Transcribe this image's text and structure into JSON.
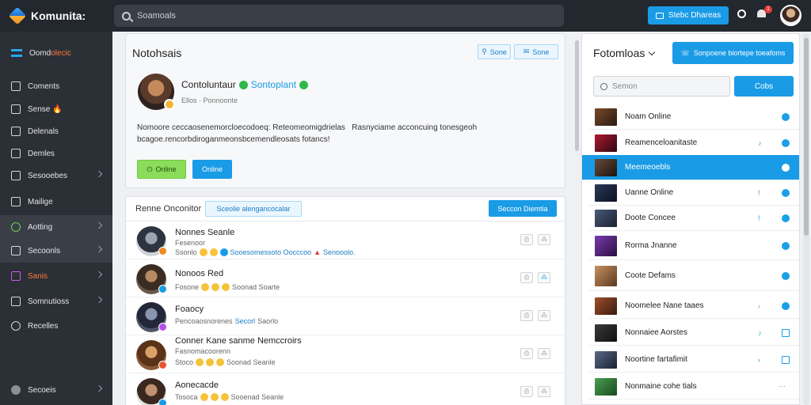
{
  "app": {
    "name": "Komunita:"
  },
  "top": {
    "search_placeholder": "Soamoals",
    "action_button": "Stebc Dhareas",
    "notif_count": "1"
  },
  "sidebar": {
    "items": [
      {
        "label": "Oomd",
        "accent": "olecic",
        "active": false
      },
      {
        "label": "Coments"
      },
      {
        "label": "Sense",
        "suffix": "🔥"
      },
      {
        "label": "Delenals"
      },
      {
        "label": "Demles"
      },
      {
        "label": "Sesooebes"
      },
      {
        "label": "Mailige"
      },
      {
        "label": "Aotting"
      },
      {
        "label": "Secoonls"
      },
      {
        "label": "Sanis"
      },
      {
        "label": "Somnutioss"
      },
      {
        "label": "Recelles"
      },
      {
        "label": "Secoeis"
      }
    ]
  },
  "notification": {
    "title": "Notohsais",
    "btn_a": "Sone",
    "btn_b": "Sone",
    "profile_name": "Contoluntaur",
    "profile_tag": "Sontoplant",
    "profile_sub": "Ellos · Ponnoonte",
    "text": "Nomoore ceccaosenemorcloecodoeq: Reteomeomigdrielas   Rasnyciame acconcuing tonesgeoh bcagoe.rencorbdiroganmeonsbcemendleosats fotancs!",
    "btn_green": "Online",
    "btn_blue": "Online"
  },
  "list": {
    "header": "Renne Onconitor",
    "tag": "Sceolie alengancocalar",
    "action": "Seccon Diemtia",
    "rows": [
      {
        "name": "Nonnes Seanle",
        "sub": "Fesenoor",
        "meta_a": "Ssonlo",
        "meta_link": "Sooesomessoto Oocccoo",
        "meta_b": "Senooolo."
      },
      {
        "name": "Nonoos Red",
        "sub": "",
        "meta_a": "Fosone",
        "meta_link": "",
        "meta_b": "Soonad Soarte"
      },
      {
        "name": "Foaocy",
        "sub": "",
        "meta_a": "Pencoaosnorenes",
        "meta_link": "Secorl",
        "meta_b": "Saorlo"
      },
      {
        "name": "Conner Kane sanme Nemccroirs",
        "sub": "Fasnomacoorenn",
        "meta_a": "Stoco",
        "meta_link": "",
        "meta_b": "Soonad Seanle"
      },
      {
        "name": "Aonecacde",
        "sub": "",
        "meta_a": "Tosoca",
        "meta_link": "",
        "meta_b": "Sooenad Seanle"
      }
    ]
  },
  "panel": {
    "title": "Fotomloas",
    "button": "Sonpoene biortepe toeafoms",
    "search_placeholder": "Semon",
    "search_button": "Cobs",
    "items": [
      {
        "name": "Noam Online",
        "selected": false,
        "tick": ""
      },
      {
        "name": "Reamenceloanitaste",
        "selected": false,
        "tick": "♪"
      },
      {
        "name": "Meemeoebls",
        "selected": true,
        "tick": ""
      },
      {
        "name": "Uanne Online",
        "selected": false,
        "tick": "ǃ"
      },
      {
        "name": "Doote Concee",
        "selected": false,
        "tick": "ǃ"
      },
      {
        "name": "Rorma Jnanne",
        "selected": false,
        "tick": ""
      },
      {
        "name": "Coote Defams",
        "selected": false,
        "tick": ""
      },
      {
        "name": "Noomelee Nane taaes",
        "selected": false,
        "tick": "›"
      },
      {
        "name": "Nonnaiee Aorstes",
        "selected": false,
        "tick": "♪"
      },
      {
        "name": "Noortine fartafimit",
        "selected": false,
        "tick": "›"
      },
      {
        "name": "Nonmaine cohe tials",
        "selected": false,
        "tick": "⋯"
      }
    ]
  }
}
